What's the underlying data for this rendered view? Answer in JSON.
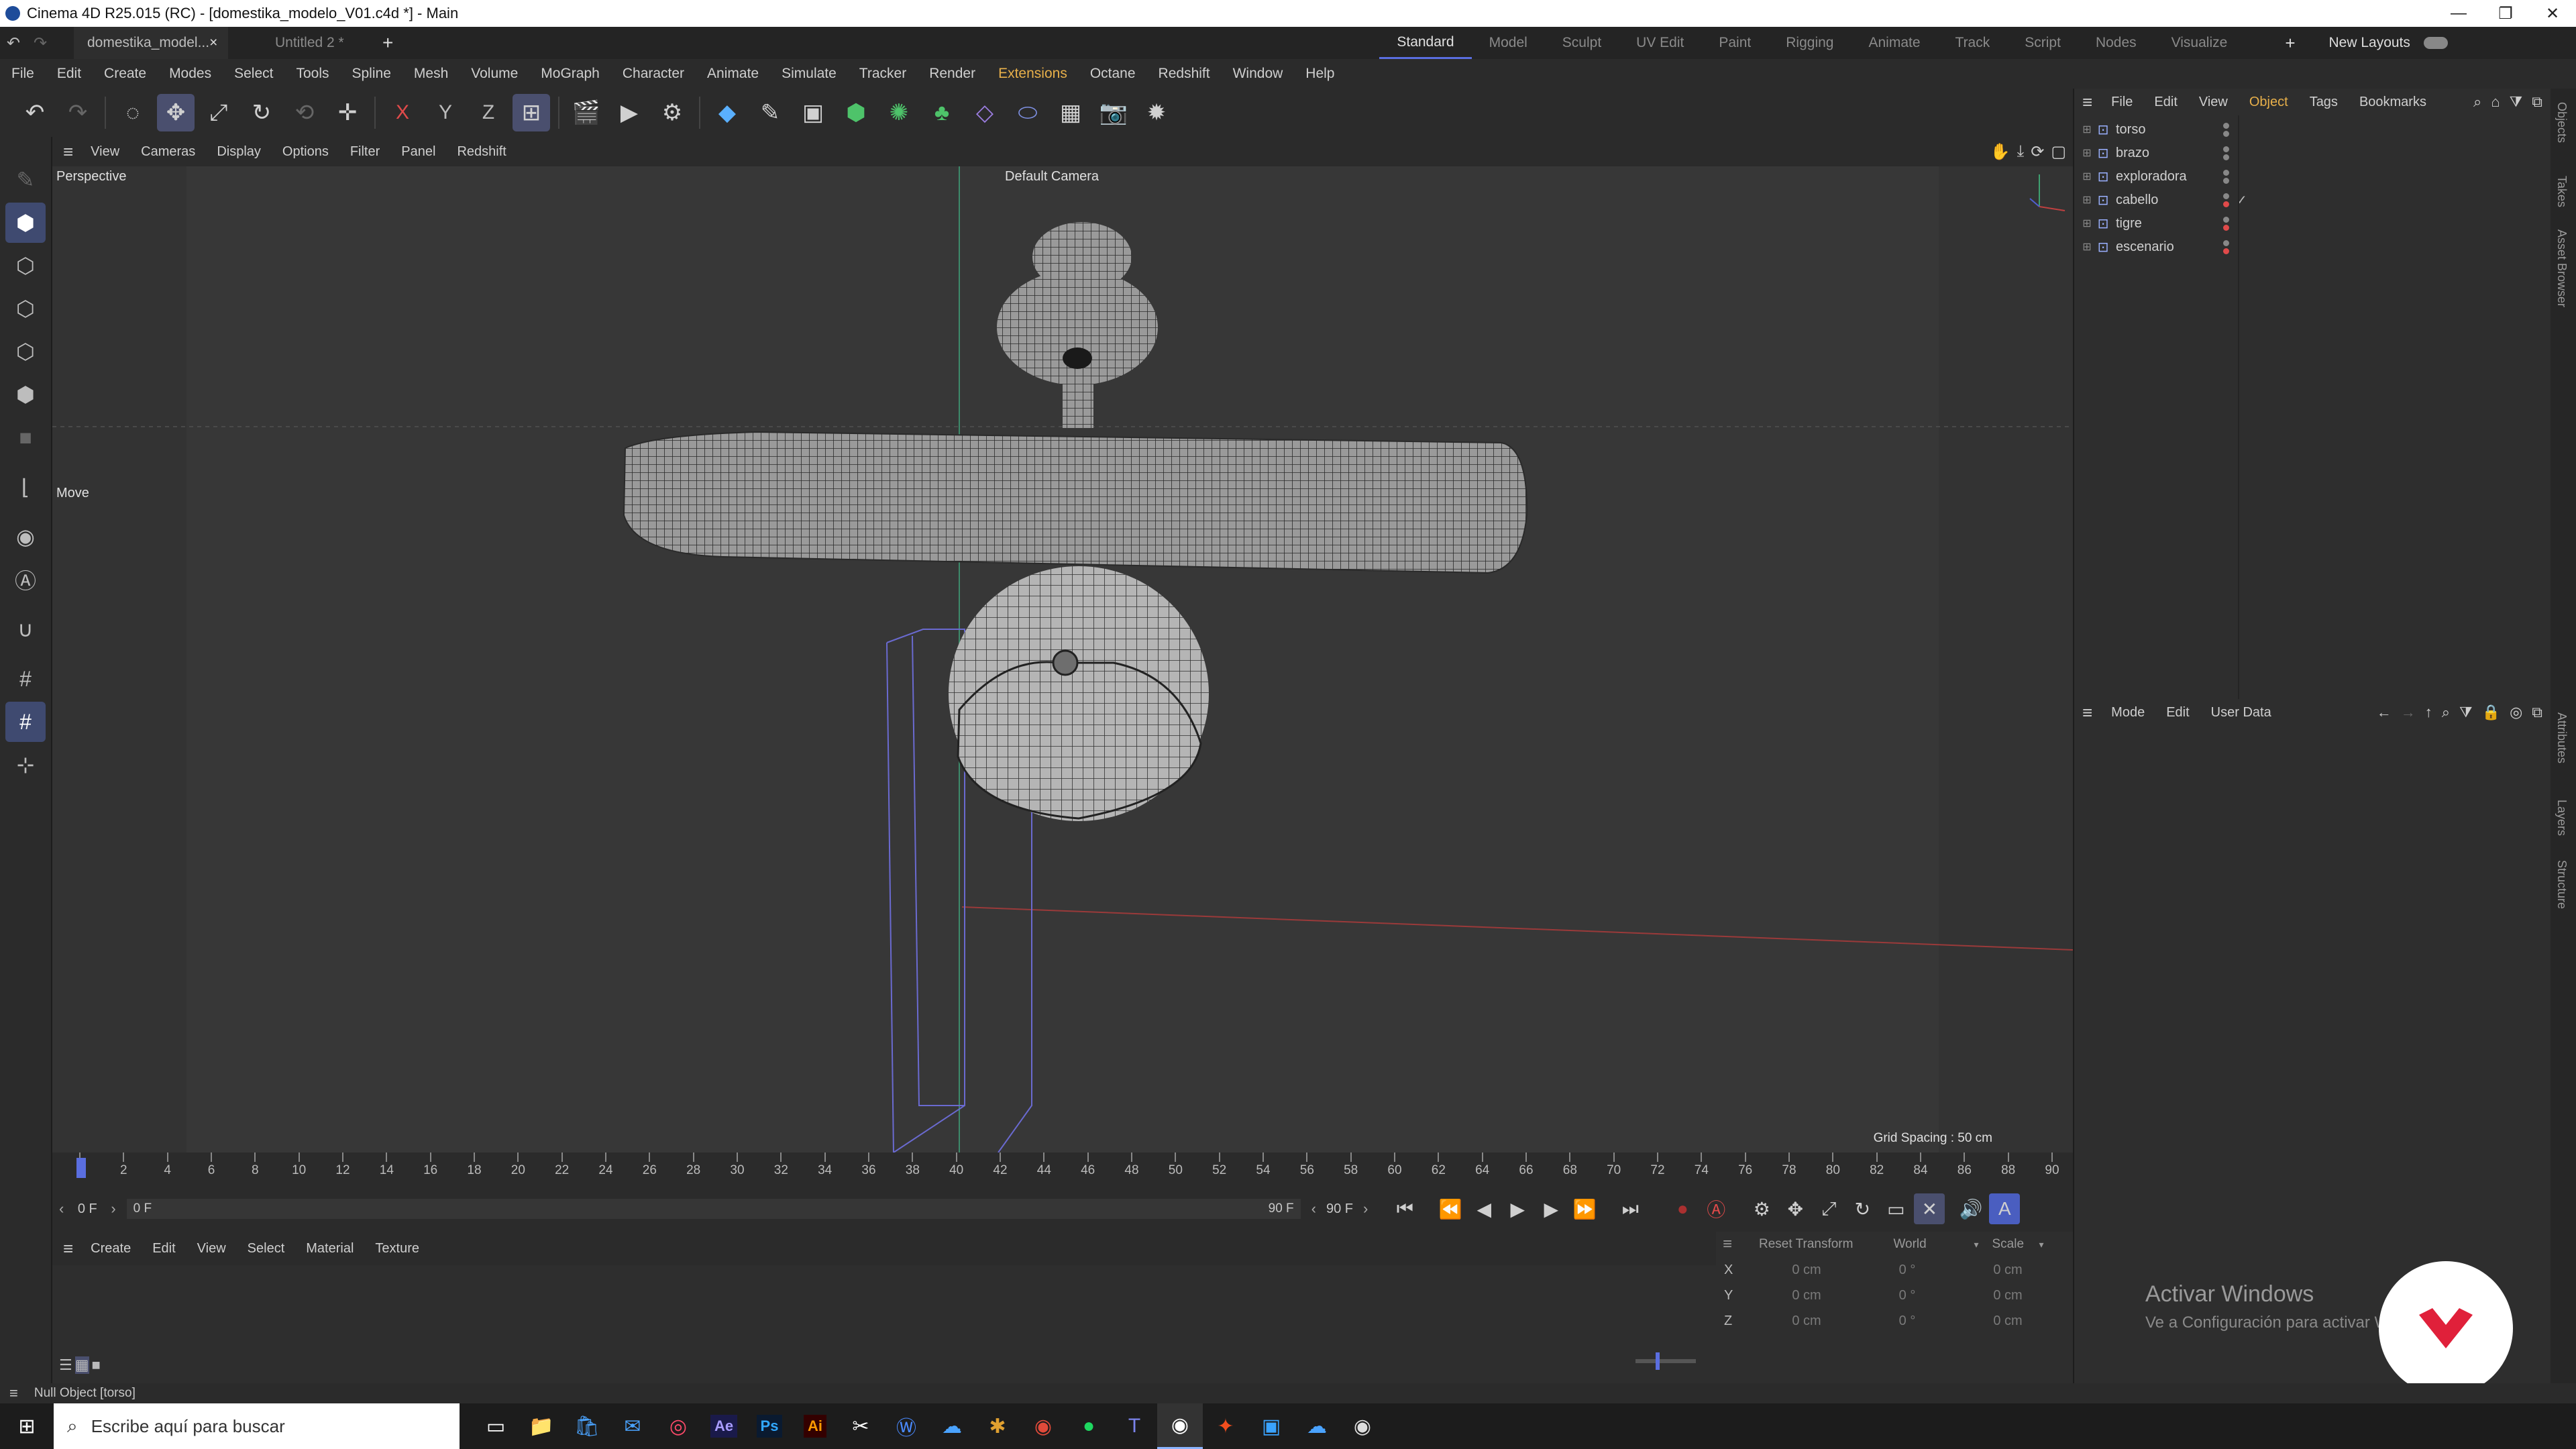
{
  "window": {
    "title": "Cinema 4D R25.015 (RC) - [domestika_modelo_V01.c4d *] - Main",
    "minimize": "—",
    "maximize": "❐",
    "close": "✕"
  },
  "doc_tabs": [
    {
      "label": "domestika_model...",
      "close": "×"
    },
    {
      "label": "Untitled 2 *"
    }
  ],
  "add_tab": "+",
  "layouts": [
    "Standard",
    "Model",
    "Sculpt",
    "UV Edit",
    "Paint",
    "Rigging",
    "Animate",
    "Track",
    "Script",
    "Nodes",
    "Visualize"
  ],
  "layouts_add": "+",
  "new_layouts": "New Layouts",
  "menus": [
    "File",
    "Edit",
    "Create",
    "Modes",
    "Select",
    "Tools",
    "Spline",
    "Mesh",
    "Volume",
    "MoGraph",
    "Character",
    "Animate",
    "Simulate",
    "Tracker",
    "Render",
    "Extensions",
    "Octane",
    "Redshift",
    "Window",
    "Help"
  ],
  "viewport": {
    "menus": [
      "View",
      "Cameras",
      "Display",
      "Options",
      "Filter",
      "Panel",
      "Redshift"
    ],
    "view_name": "Perspective",
    "camera": "Default Camera",
    "tool": "Move",
    "grid_spacing": "Grid Spacing : 50 cm"
  },
  "timeline": {
    "ticks": [
      "0",
      "2",
      "4",
      "6",
      "8",
      "10",
      "12",
      "14",
      "16",
      "18",
      "20",
      "22",
      "24",
      "26",
      "28",
      "30",
      "32",
      "34",
      "36",
      "38",
      "40",
      "42",
      "44",
      "46",
      "48",
      "50",
      "52",
      "54",
      "56",
      "58",
      "60",
      "62",
      "64",
      "66",
      "68",
      "70",
      "72",
      "74",
      "76",
      "78",
      "80",
      "82",
      "84",
      "86",
      "88",
      "90"
    ]
  },
  "playback": {
    "current": "0 F",
    "range_start": "0 F",
    "range_end": "90 F",
    "end": "90 F"
  },
  "material_menus": [
    "Create",
    "Edit",
    "View",
    "Select",
    "Material",
    "Texture"
  ],
  "coords": {
    "reset": "Reset Transform",
    "space": "World",
    "mode": "Scale",
    "rows": [
      {
        "axis": "X",
        "pos": "0 cm",
        "rot": "0 °",
        "size": "0 cm"
      },
      {
        "axis": "Y",
        "pos": "0 cm",
        "rot": "0 °",
        "size": "0 cm"
      },
      {
        "axis": "Z",
        "pos": "0 cm",
        "rot": "0 °",
        "size": "0 cm"
      }
    ]
  },
  "object_manager": {
    "menus": [
      "File",
      "Edit",
      "View",
      "Object",
      "Tags",
      "Bookmarks"
    ],
    "objects": [
      "torso",
      "brazo",
      "exploradora",
      "cabello",
      "tigre",
      "escenario"
    ]
  },
  "attributes": {
    "menus": [
      "Mode",
      "Edit",
      "User Data"
    ]
  },
  "side_tabs": [
    "Objects",
    "Takes",
    "Asset Browser",
    "Attributes",
    "Layers",
    "Structure"
  ],
  "watermark": {
    "title": "Activar Windows",
    "subtitle": "Ve a Configuración para activar Windows."
  },
  "status": "Null Object [torso]",
  "taskbar": {
    "search": "Escribe aquí para buscar"
  },
  "colors": {
    "accent": "#5a6ee0",
    "red": "#e04a4a",
    "domestika": "#e0203a"
  }
}
